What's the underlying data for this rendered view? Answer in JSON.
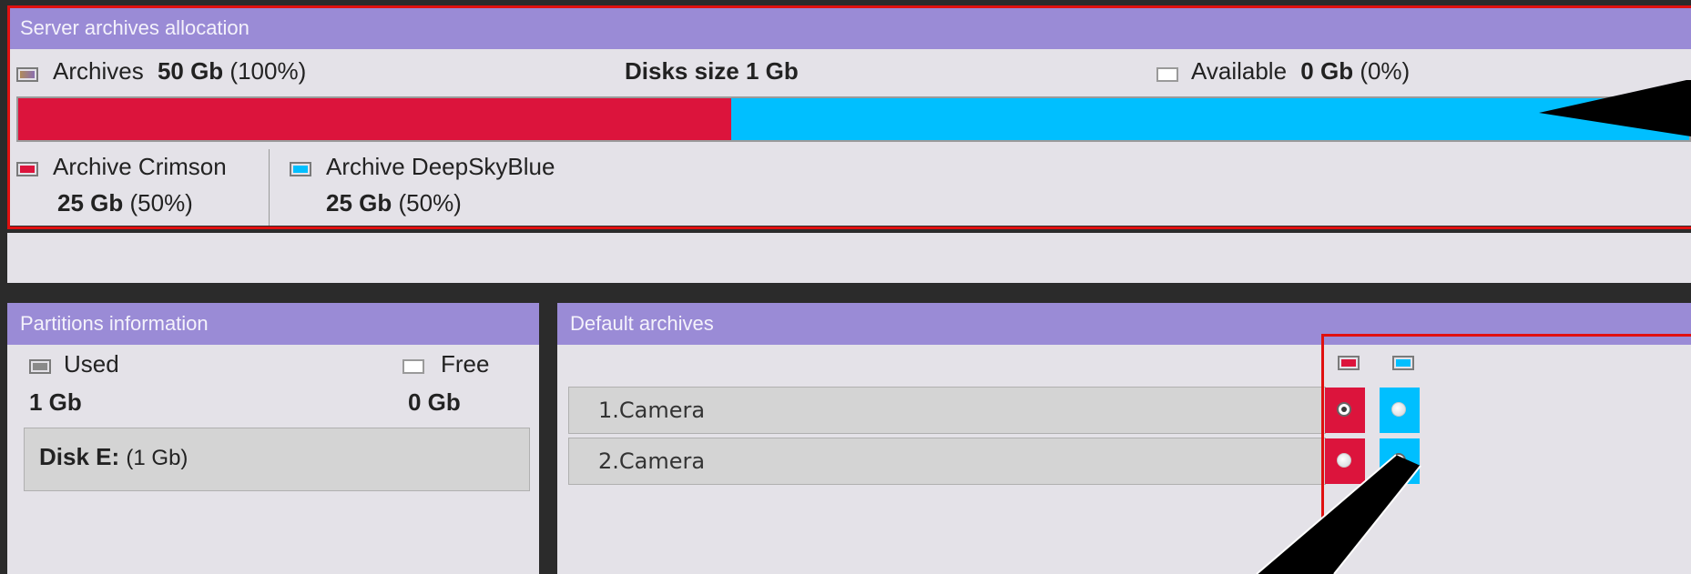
{
  "colors": {
    "header": "#9a8bd6",
    "crimson": "#dc143c",
    "deepskyblue": "#00bfff",
    "highlight": "#e01010",
    "panel": "#e4e2e8"
  },
  "server": {
    "title": "Server archives allocation",
    "archives_label": "Archives",
    "archives_value": "50 Gb",
    "archives_pct": "(100%)",
    "disks_size": "Disks size 1 Gb",
    "available_label": "Available",
    "available_value": "0 Gb",
    "available_pct": "(0%)",
    "bar": {
      "crimson_fraction": 0.5,
      "deepskyblue_fraction": 0.5
    },
    "legend": [
      {
        "name": "Archive Crimson",
        "value": "25 Gb",
        "pct": "(50%)",
        "color": "#dc143c"
      },
      {
        "name": "Archive DeepSkyBlue",
        "value": "25 Gb",
        "pct": "(50%)",
        "color": "#00bfff"
      }
    ]
  },
  "partitions": {
    "title": "Partitions information",
    "used_label": "Used",
    "used_value": "1 Gb",
    "free_label": "Free",
    "free_value": "0 Gb",
    "disk_label": "Disk E:",
    "disk_size": "(1 Gb)"
  },
  "defaults": {
    "title": "Default archives",
    "columns": [
      "crimson",
      "deepskyblue"
    ],
    "cameras": [
      {
        "name": "1.Camera",
        "selected": "crimson"
      },
      {
        "name": "2.Camera",
        "selected": "deepskyblue"
      }
    ]
  }
}
